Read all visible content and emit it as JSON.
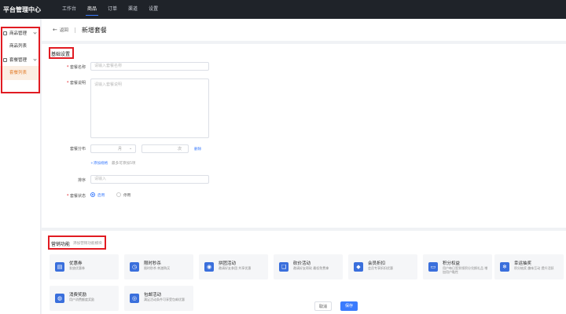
{
  "app": {
    "title": "平台管理中心"
  },
  "topnav": [
    {
      "label": "工作台"
    },
    {
      "label": "商品"
    },
    {
      "label": "订单"
    },
    {
      "label": "渠道"
    },
    {
      "label": "设置"
    }
  ],
  "sidebar": {
    "groups": [
      {
        "label": "商品管理",
        "items": [
          {
            "label": "商品列表"
          }
        ]
      },
      {
        "label": "套餐管理",
        "items": [
          {
            "label": "套餐列表"
          }
        ]
      }
    ]
  },
  "header": {
    "back_label": "返回",
    "title": "新增套餐"
  },
  "basic": {
    "section_title": "基础设置",
    "name": {
      "label": "套餐名称",
      "placeholder": "请输入套餐名称"
    },
    "desc": {
      "label": "套餐说明",
      "placeholder": "请输入套餐说明"
    },
    "allocation": {
      "label": "套餐分布",
      "unit1": "月",
      "unit2": "次",
      "tag": "删除",
      "add_link": "+添加规格",
      "hint": "最多可添加5项"
    },
    "sort": {
      "label": "排序",
      "placeholder": "请输入"
    },
    "status": {
      "label": "套餐状态",
      "options": [
        "启用",
        "停用"
      ]
    }
  },
  "features": {
    "section_title": "营销功能",
    "section_hint": "添加营销功能模块",
    "items": [
      {
        "name": "优惠券",
        "desc": "发放优惠券",
        "icon": "coupon-icon",
        "glyph": "▤"
      },
      {
        "name": "限时秒杀",
        "desc": "限时秒杀 刺激购买",
        "icon": "clock-icon",
        "glyph": "◷"
      },
      {
        "name": "拼团活动",
        "desc": "邀请好友参团 共享优惠",
        "icon": "group-icon",
        "glyph": "◉"
      },
      {
        "name": "砍价活动",
        "desc": "邀请好友帮砍 最低免费拿",
        "icon": "chat-icon",
        "glyph": "❑"
      },
      {
        "name": "会员折扣",
        "desc": "会员专享折扣优惠",
        "icon": "diamond-icon",
        "glyph": "◆"
      },
      {
        "name": "积分权益",
        "desc": "用户每日签到领积分兑换礼品 增加用户黏性",
        "icon": "card-icon",
        "glyph": "▭"
      },
      {
        "name": "幸运抽奖",
        "desc": "积分抽奖 趣味互动 提升活跃",
        "icon": "snowflake-icon",
        "glyph": "❄"
      },
      {
        "name": "消费奖励",
        "desc": "用户消费额度奖励",
        "icon": "bag-icon",
        "glyph": "◍"
      },
      {
        "name": "包邮活动",
        "desc": "满足活动条件可享受包邮优惠",
        "icon": "globe-icon",
        "glyph": "◎"
      }
    ]
  },
  "footer": {
    "cancel_label": "取消",
    "save_label": "保存"
  },
  "colors": {
    "primary": "#3a7bfd",
    "highlight_border": "#e11b22",
    "topbar_bg": "#1f2329",
    "active_menu": "#e27d2a"
  }
}
